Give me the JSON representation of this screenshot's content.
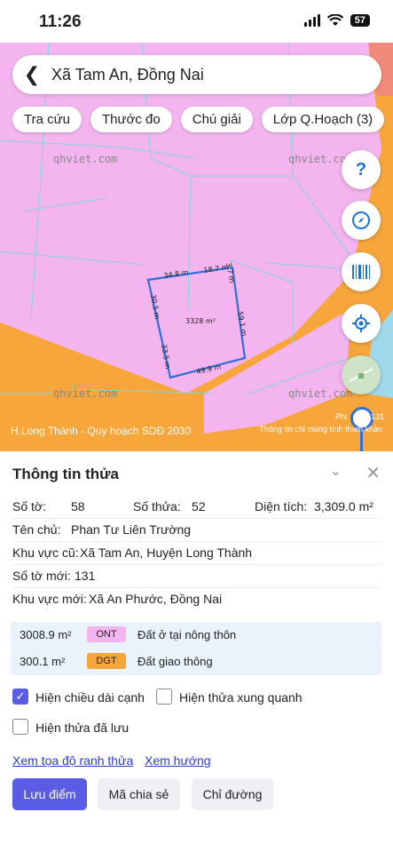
{
  "status": {
    "time": "11:26",
    "battery": "57"
  },
  "search": {
    "back_icon": "chevron-left-icon",
    "text": "Xã Tam An, Đồng Nai"
  },
  "chips": [
    "Tra cứu",
    "Thước đo",
    "Chú giải",
    "Lớp Q.Hoạch (3)"
  ],
  "map": {
    "watermarks": [
      "qhviet.com",
      "qhviet.com",
      "qhviet.com",
      "qhviet.com"
    ],
    "area_label": "3328 m²",
    "edges": [
      "34.8 m",
      "18.7 m",
      "3.7 m",
      "30.5 m",
      "59.1 m",
      "33.5 m",
      "49.9 m"
    ],
    "plan_label": "H.Long Thành - Quy hoạch SDĐ 2030",
    "note": "Thông tin chỉ mang tính tham khảo",
    "ph_label": "Phi",
    "num_label": "131",
    "colors": {
      "residential": "#f4b4ef",
      "road": "#f7a63b",
      "boundary": "#2f6fd6"
    }
  },
  "panel": {
    "title": "Thông tin thửa",
    "so_to_label": "Số tờ:",
    "so_to": "58",
    "so_thua_label": "Số thửa:",
    "so_thua": "52",
    "dien_tich_label": "Diện tích:",
    "dien_tich": "3,309.0 m²",
    "chu_label": "Tên chủ:",
    "chu": "Phan Tư Liên Trường",
    "kv_cu_label": "Khu vực cũ:",
    "kv_cu": "Xã Tam An, Huyện Long Thành",
    "so_to_moi_label": "Số tờ mới:",
    "so_to_moi": "131",
    "kv_moi_label": "Khu vực mới:",
    "kv_moi": "Xã An Phước, Đồng Nai",
    "landuse": [
      {
        "area": "3008.9 m²",
        "code": "ONT",
        "desc": "Đất ở tại nông thôn",
        "color": "#f4b4ef"
      },
      {
        "area": "300.1 m²",
        "code": "DGT",
        "desc": "Đất giao thông",
        "color": "#f7a63b"
      }
    ],
    "checks": [
      {
        "label": "Hiện chiều dài cạnh",
        "checked": true
      },
      {
        "label": "Hiện thửa xung quanh",
        "checked": false
      },
      {
        "label": "Hiện thửa đã lưu",
        "checked": false
      }
    ],
    "links": [
      "Xem tọa độ ranh thửa",
      "Xem hướng"
    ],
    "buttons": [
      "Lưu điểm",
      "Mã chia sẻ",
      "Chỉ đường"
    ]
  }
}
